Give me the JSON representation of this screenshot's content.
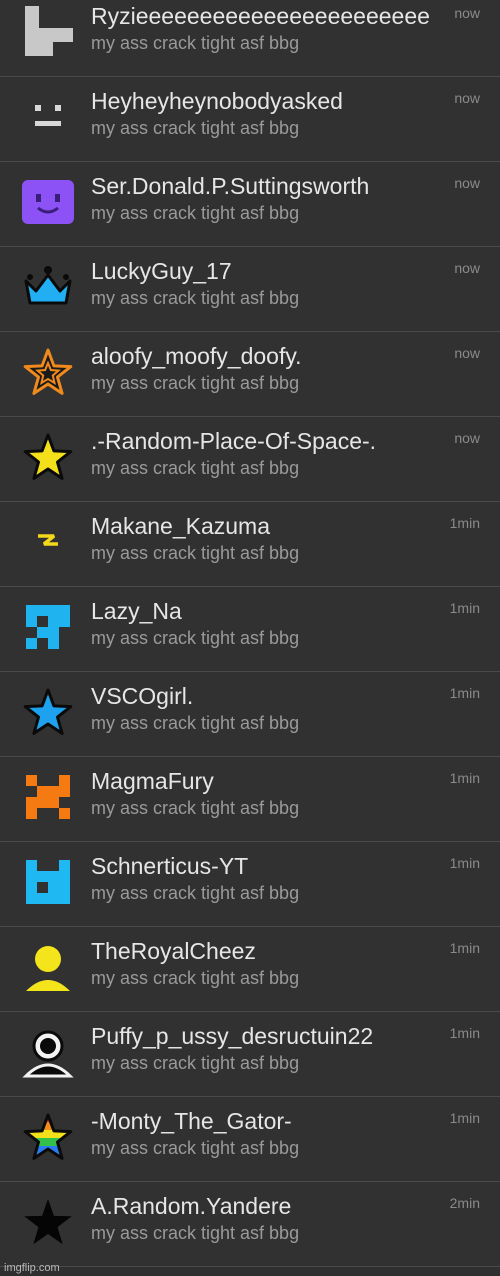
{
  "rows": [
    {
      "name": "Ryzieeeeeeeeeeeeeeeeeeeeeee",
      "message": "my ass crack tight asf bbg",
      "time": "now",
      "icon": "grey-block-face-icon"
    },
    {
      "name": "Heyheyheynobodyasked",
      "message": "my ass crack tight asf bbg",
      "time": "now",
      "icon": "small-face-icon"
    },
    {
      "name": "Ser.Donald.P.Suttingsworth",
      "message": "my ass crack tight asf bbg",
      "time": "now",
      "icon": "purple-face-icon"
    },
    {
      "name": "LuckyGuy_17",
      "message": "my ass crack tight asf bbg",
      "time": "now",
      "icon": "blue-crown-icon"
    },
    {
      "name": "aloofy_moofy_doofy.",
      "message": "my ass crack tight asf bbg",
      "time": "now",
      "icon": "orange-outline-star-icon"
    },
    {
      "name": ".-Random-Place-Of-Space-.",
      "message": "my ass crack tight asf bbg",
      "time": "now",
      "icon": "yellow-star-icon"
    },
    {
      "name": "Makane_Kazuma",
      "message": "my ass crack tight asf bbg",
      "time": "1min",
      "icon": "lightning-icon"
    },
    {
      "name": "Lazy_Na",
      "message": "my ass crack tight asf bbg",
      "time": "1min",
      "icon": "cyan-pixel-icon"
    },
    {
      "name": "VSCOgirl.",
      "message": "my ass crack tight asf bbg",
      "time": "1min",
      "icon": "blue-star-icon"
    },
    {
      "name": "MagmaFury",
      "message": "my ass crack tight asf bbg",
      "time": "1min",
      "icon": "orange-x-pixel-icon"
    },
    {
      "name": "Schnerticus-YT",
      "message": "my ass crack tight asf bbg",
      "time": "1min",
      "icon": "cyan-checker-pixel-icon"
    },
    {
      "name": "TheRoyalCheez",
      "message": "my ass crack tight asf bbg",
      "time": "1min",
      "icon": "yellow-person-icon"
    },
    {
      "name": "Puffy_p_ussy_desructuin22",
      "message": "my ass crack tight asf bbg",
      "time": "1min",
      "icon": "white-person-icon"
    },
    {
      "name": "-Monty_The_Gator-",
      "message": "my ass crack tight asf bbg",
      "time": "1min",
      "icon": "rainbow-star-icon"
    },
    {
      "name": "A.Random.Yandere",
      "message": "my ass crack tight asf bbg",
      "time": "2min",
      "icon": "black-star-icon"
    }
  ],
  "watermark": "imgflip.com"
}
